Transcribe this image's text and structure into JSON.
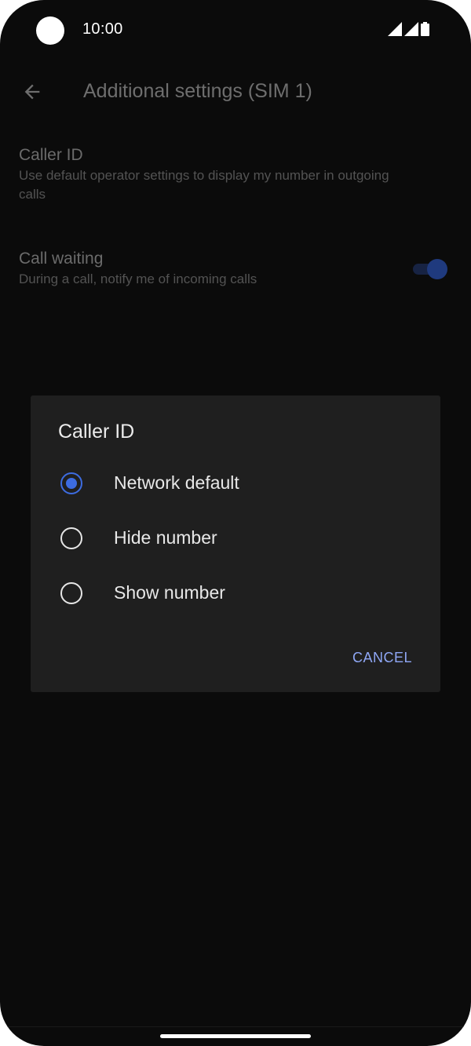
{
  "status_bar": {
    "time": "10:00",
    "icons": [
      "signal-icon",
      "signal-icon",
      "battery-icon"
    ]
  },
  "app_bar": {
    "back_icon": "arrow-back-icon",
    "title": "Additional settings (SIM 1)"
  },
  "settings": [
    {
      "title": "Caller ID",
      "summary": "Use default operator settings to display my number in outgoing calls"
    },
    {
      "title": "Call waiting",
      "summary": "During a call, notify me of incoming calls",
      "toggle_on": true
    }
  ],
  "dialog": {
    "title": "Caller ID",
    "options": [
      {
        "label": "Network default",
        "selected": true
      },
      {
        "label": "Hide number",
        "selected": false
      },
      {
        "label": "Show number",
        "selected": false
      }
    ],
    "cancel_label": "CANCEL"
  },
  "colors": {
    "accent": "#3d6ce0",
    "button_text": "#8fa7f5",
    "background": "#0b0b0b",
    "dialog_background": "#1f1f1f"
  }
}
